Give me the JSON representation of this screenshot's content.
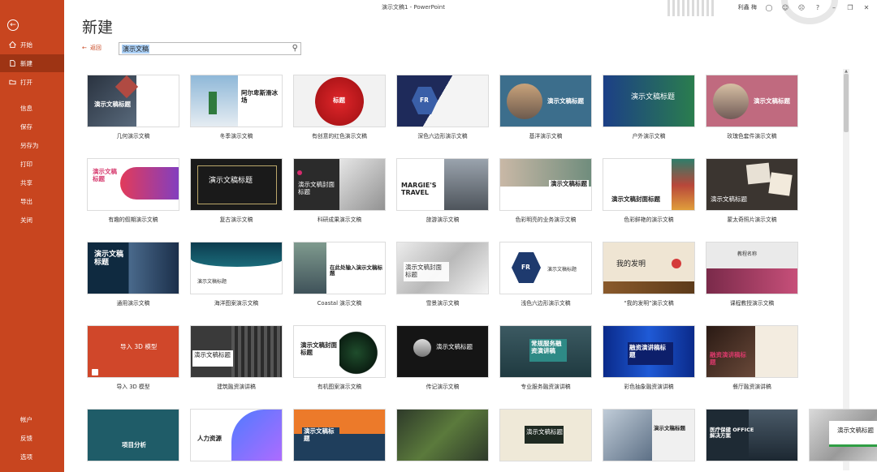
{
  "titlebar": {
    "title": "演示文稿1 - PowerPoint",
    "user": "利鑫 梅",
    "help": "?"
  },
  "sidebar": {
    "items": [
      {
        "label": "开始"
      },
      {
        "label": "新建"
      },
      {
        "label": "打开"
      },
      {
        "label": "信息"
      },
      {
        "label": "保存"
      },
      {
        "label": "另存为"
      },
      {
        "label": "打印"
      },
      {
        "label": "共享"
      },
      {
        "label": "导出"
      },
      {
        "label": "关闭"
      },
      {
        "label": "帐户"
      },
      {
        "label": "反馈"
      },
      {
        "label": "选项"
      }
    ]
  },
  "header": {
    "title": "新建",
    "back_label": "返回",
    "search_value": "演示文稿"
  },
  "templates": [
    {
      "caption": "几何演示文稿",
      "thumb_title": "演示文稿标题"
    },
    {
      "caption": "冬季演示文稿",
      "thumb_title": "阿尔卑斯滑冰场"
    },
    {
      "caption": "有创意的红色演示文稿",
      "thumb_title": "标题"
    },
    {
      "caption": "深色六边形演示文稿",
      "thumb_title": "FR"
    },
    {
      "caption": "基洋演示文稿",
      "thumb_title": "演示文稿标题"
    },
    {
      "caption": "户外演示文稿",
      "thumb_title": "演示文稿标题"
    },
    {
      "caption": "玫瑰色套件演示文稿",
      "thumb_title": "演示文稿标题"
    },
    {
      "caption": "有趣的假期演示文稿",
      "thumb_title": "演示文稿标题"
    },
    {
      "caption": "复古演示文稿",
      "thumb_title": "演示文稿标题"
    },
    {
      "caption": "科研成果演示文稿",
      "thumb_title": "演示文稿封面标题"
    },
    {
      "caption": "旅游演示文稿",
      "thumb_title": "MARGIE'S TRAVEL"
    },
    {
      "caption": "色彩明亮的业务演示文稿",
      "thumb_title": "演示文稿标题"
    },
    {
      "caption": "色彩鲜艳的演示文稿",
      "thumb_title": "演示文稿封面标题"
    },
    {
      "caption": "蒙太奇照片演示文稿",
      "thumb_title": "演示文稿标题"
    },
    {
      "caption": "通用演示文稿",
      "thumb_title": "演示文稿标题"
    },
    {
      "caption": "海洋图案演示文稿",
      "thumb_title": "演示文稿标题"
    },
    {
      "caption": "Coastal 演示文稿",
      "thumb_title": "在此处输入演示文稿标题"
    },
    {
      "caption": "雪景演示文稿",
      "thumb_title": "演示文稿封面标题"
    },
    {
      "caption": "浅色六边形演示文稿",
      "thumb_title": "FR"
    },
    {
      "caption": "“我的发明”演示文稿",
      "thumb_title": "我的发明"
    },
    {
      "caption": "课程教授演示文稿",
      "thumb_title": "教程名称"
    },
    {
      "caption": "导入 3D 模型",
      "thumb_title": "导入 3D 模型"
    },
    {
      "caption": "建筑融资演讲稿",
      "thumb_title": "演示文稿标题"
    },
    {
      "caption": "有机图案演示文稿",
      "thumb_title": "演示文稿封面标题"
    },
    {
      "caption": "传记演示文稿",
      "thumb_title": "演示文稿标题"
    },
    {
      "caption": "专业服务融资演讲稿",
      "thumb_title": "常规服务融资演讲稿"
    },
    {
      "caption": "彩色抽象融资演讲稿",
      "thumb_title": "融资演讲稿标题"
    },
    {
      "caption": "餐厅融资演讲稿",
      "thumb_title": "融资演讲稿标题"
    },
    {
      "caption": "",
      "thumb_title": "项目分析"
    },
    {
      "caption": "",
      "thumb_title": "人力资源"
    },
    {
      "caption": "",
      "thumb_title": "演示文稿标题"
    },
    {
      "caption": "",
      "thumb_title": ""
    },
    {
      "caption": "",
      "thumb_title": "演示文稿标题"
    },
    {
      "caption": "",
      "thumb_title": "演示文稿标题"
    },
    {
      "caption": "",
      "thumb_title": "医疗保健 OFFICE 解决方案"
    },
    {
      "caption": "",
      "thumb_title": "演示文稿标题"
    }
  ]
}
